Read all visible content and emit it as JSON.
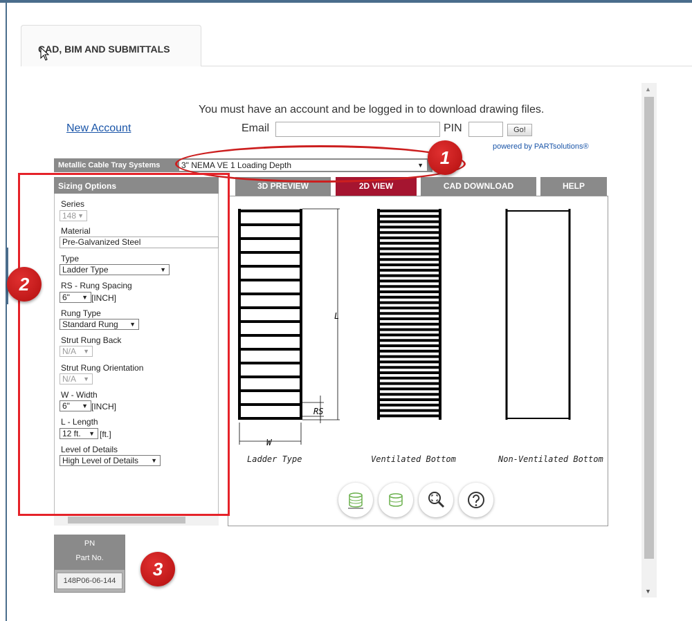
{
  "tab": {
    "label": "CAD, BIM AND SUBMITTALS"
  },
  "login": {
    "message": "You must have an account and be logged in to download drawing files.",
    "new_account": "New Account",
    "email_label": "Email",
    "pin_label": "PIN",
    "go_label": "Go!",
    "powered_by": "powered by PARTsolutions®"
  },
  "category": {
    "label": "Metallic Cable Tray Systems",
    "selected": "3\" NEMA VE 1 Loading Depth"
  },
  "sizing": {
    "header": "Sizing Options",
    "series_label": "Series",
    "series_value": "148",
    "material_label": "Material",
    "material_value": "Pre-Galvanized Steel",
    "type_label": "Type",
    "type_value": "Ladder Type",
    "rs_label": "RS - Rung Spacing",
    "rs_value": "6\"",
    "rs_unit": "[INCH]",
    "rung_type_label": "Rung Type",
    "rung_type_value": "Standard Rung",
    "strut_back_label": "Strut Rung Back",
    "strut_back_value": "N/A",
    "strut_orient_label": "Strut Rung Orientation",
    "strut_orient_value": "N/A",
    "width_label": "W - Width",
    "width_value": "6\"",
    "width_unit": "[INCH]",
    "length_label": "L - Length",
    "length_value": "12 ft.",
    "length_unit": "[ft.]",
    "detail_label": "Level of Details",
    "detail_value": "High Level of Details"
  },
  "view_tabs": [
    "3D PREVIEW",
    "2D VIEW",
    "CAD DOWNLOAD",
    "HELP"
  ],
  "active_tab": "2D VIEW",
  "drawings": {
    "ladder_caption": "Ladder Type",
    "vent_caption": "Ventilated Bottom",
    "nonvent_caption": "Non-Ventilated Bottom",
    "dim_l": "L",
    "dim_rs": "RS",
    "dim_w": "W"
  },
  "part": {
    "pn_label": "PN",
    "part_no_label": "Part No.",
    "part_no_value": "148P06-06-144"
  },
  "callouts": [
    "1",
    "2",
    "3"
  ],
  "colors": {
    "active_tab": "#a51530",
    "callout": "#c41a1a",
    "header_gray": "#8a8a8a",
    "link": "#1a55a8"
  },
  "icons": [
    "measure-tray-icon",
    "tray-icon",
    "zoom-fit-icon",
    "help-icon"
  ]
}
